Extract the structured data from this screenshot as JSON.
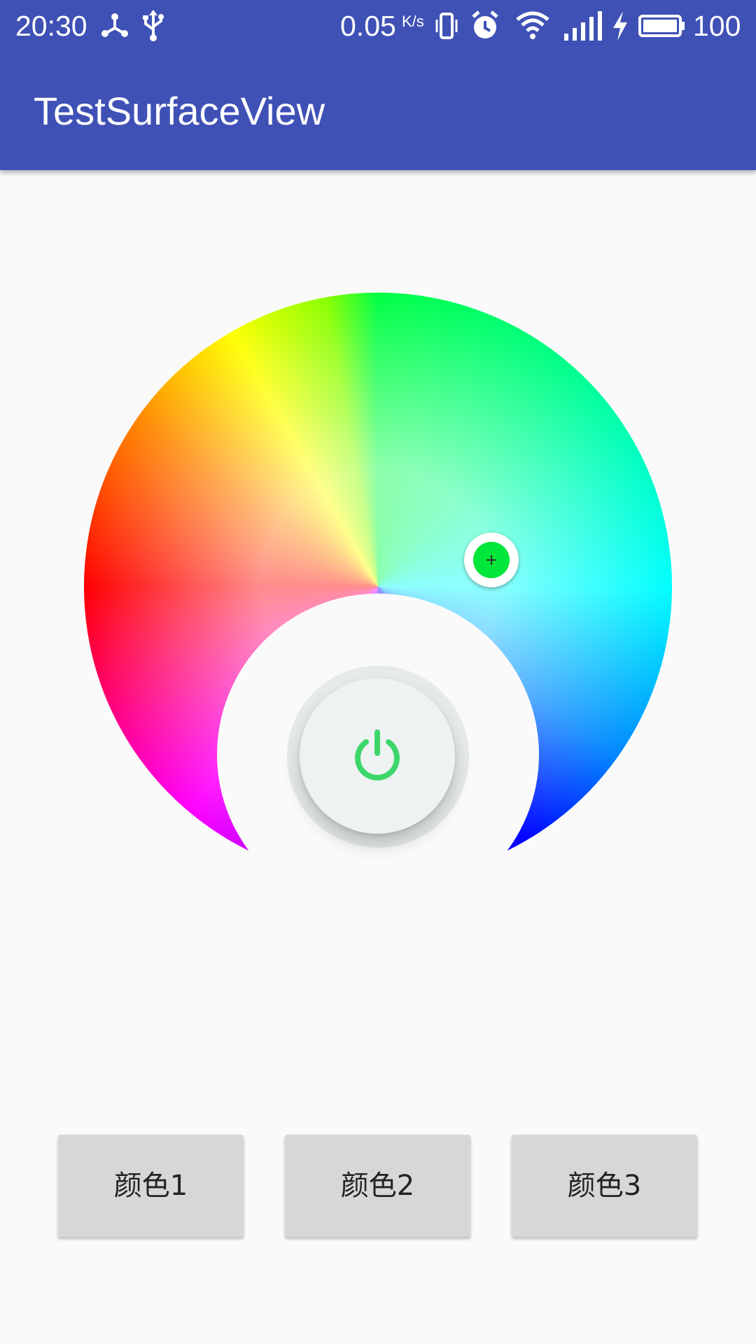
{
  "status_bar": {
    "time": "20:30",
    "net_speed": "0.05",
    "net_speed_unit": "K/s",
    "battery_level": "100",
    "icons": [
      "share-node-icon",
      "usb-icon",
      "vibrate-icon",
      "alarm-icon",
      "wifi-icon",
      "signal-icon",
      "charging-bolt-icon",
      "battery-icon"
    ]
  },
  "app_bar": {
    "title": "TestSurfaceView"
  },
  "color_wheel": {
    "selected_color": "#00e63a",
    "power_icon_color": "#3dd66a"
  },
  "buttons": [
    {
      "label": "颜色1"
    },
    {
      "label": "颜色2"
    },
    {
      "label": "颜色3"
    }
  ],
  "colors": {
    "primary": "#3f51b5",
    "background": "#fafafa",
    "button_bg": "#d6d7d7"
  }
}
